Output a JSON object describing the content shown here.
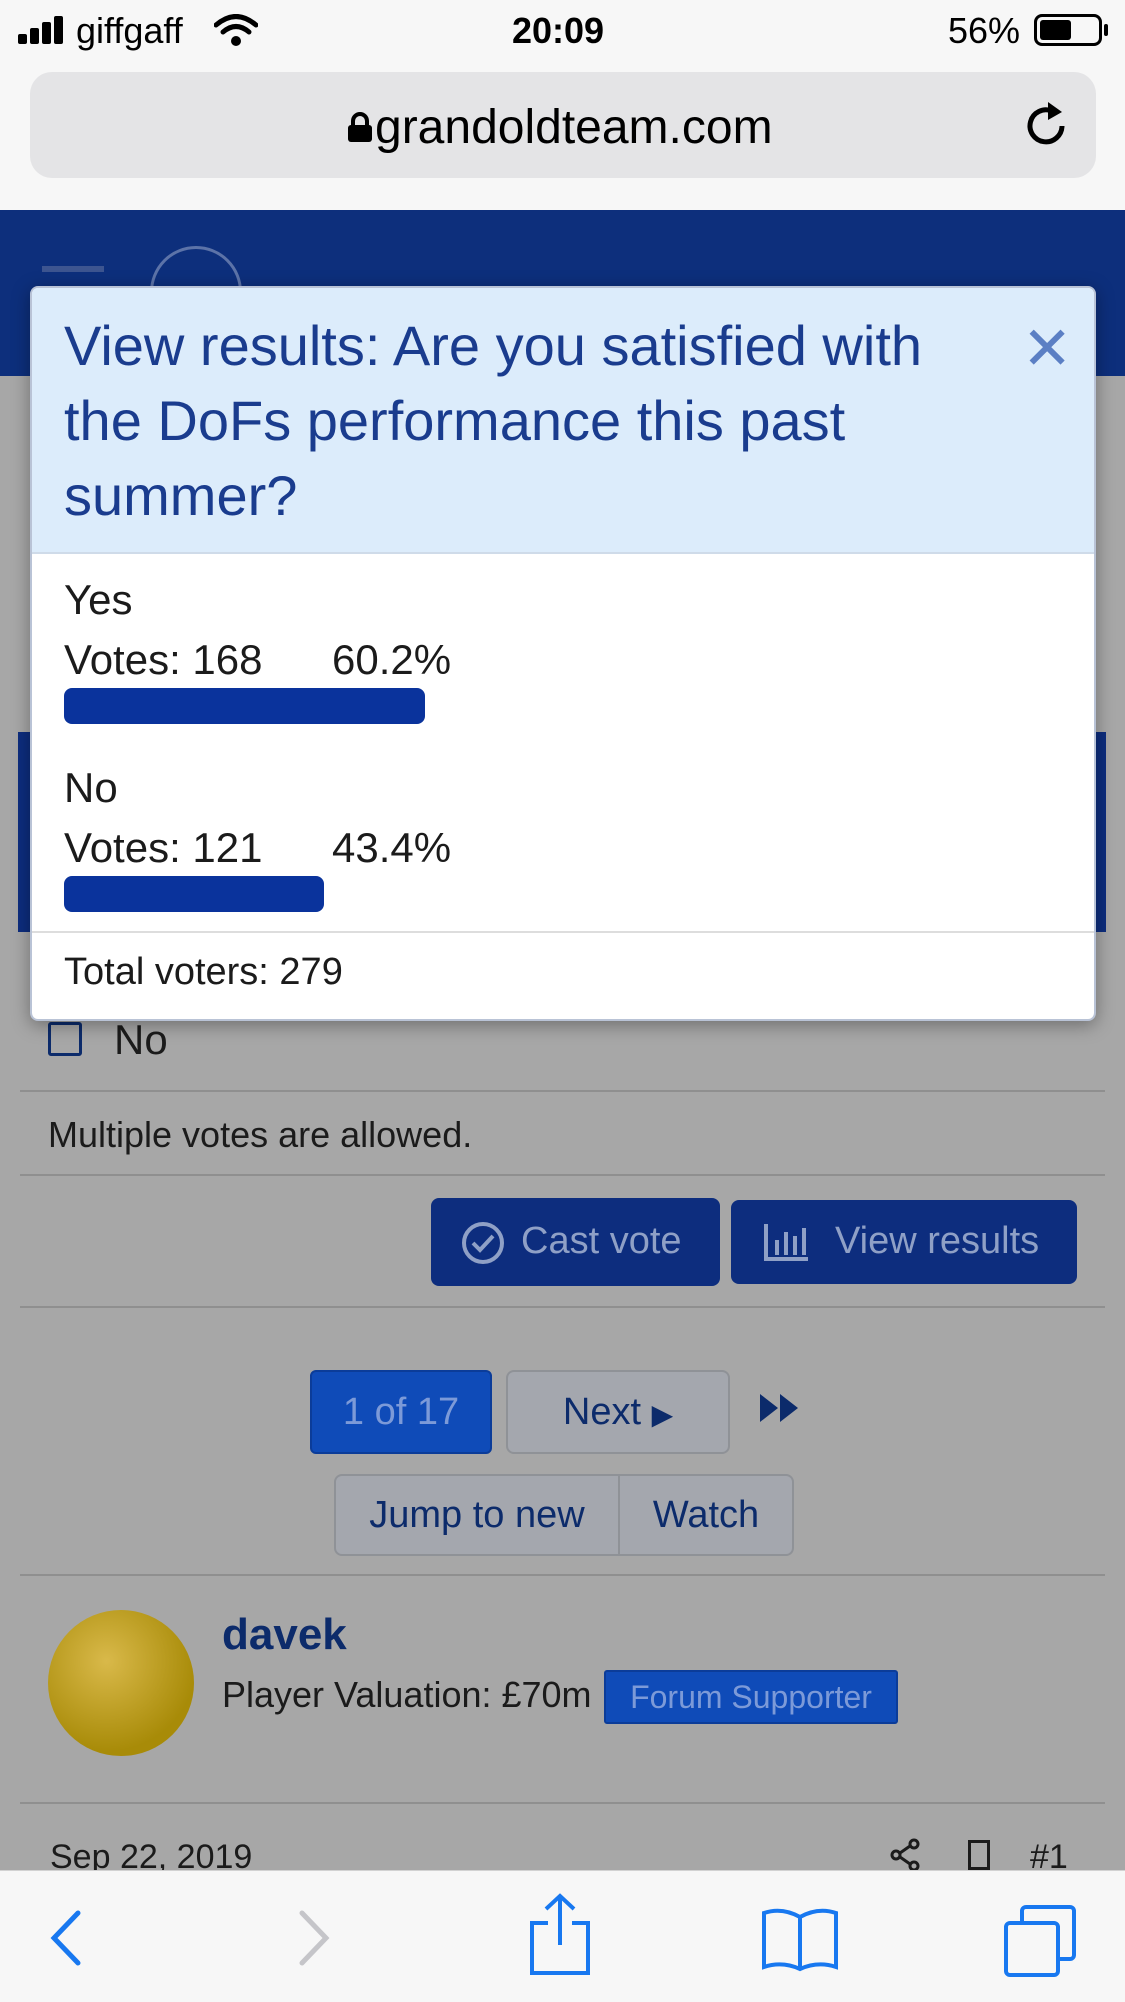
{
  "status_bar": {
    "carrier": "giffgaff",
    "time": "20:09",
    "battery": "56%",
    "battery_level": 0.56
  },
  "browser": {
    "url": "grandoldteam.com"
  },
  "page": {
    "poll_option_no": "No",
    "multiple_votes_note": "Multiple votes are allowed.",
    "cast_vote_label": "Cast vote",
    "view_results_label": "View results",
    "pagination": {
      "current": "1 of 17",
      "next": "Next"
    },
    "jump_to_new": "Jump to new",
    "watch": "Watch",
    "post": {
      "username": "davek",
      "valuation": "Player Valuation: £70m",
      "badge": "Forum Supporter",
      "date": "Sep 22, 2019",
      "number": "#1"
    }
  },
  "modal": {
    "title": "View results: Are you satisfied with the DoFs performance this past summer?",
    "close_icon": "close-icon",
    "options": [
      {
        "label": "Yes",
        "votes_text": "Votes: 168",
        "percent_text": "60.2%",
        "percent": 60.2
      },
      {
        "label": "No",
        "votes_text": "Votes: 121",
        "percent_text": "43.4%",
        "percent": 43.4
      }
    ],
    "total_voters": "Total voters: 279"
  },
  "colors": {
    "brand_blue": "#0d2f7c",
    "bar_blue": "#0a339c",
    "modal_header": "#dcecfb",
    "title_blue": "#1a3c8e"
  }
}
